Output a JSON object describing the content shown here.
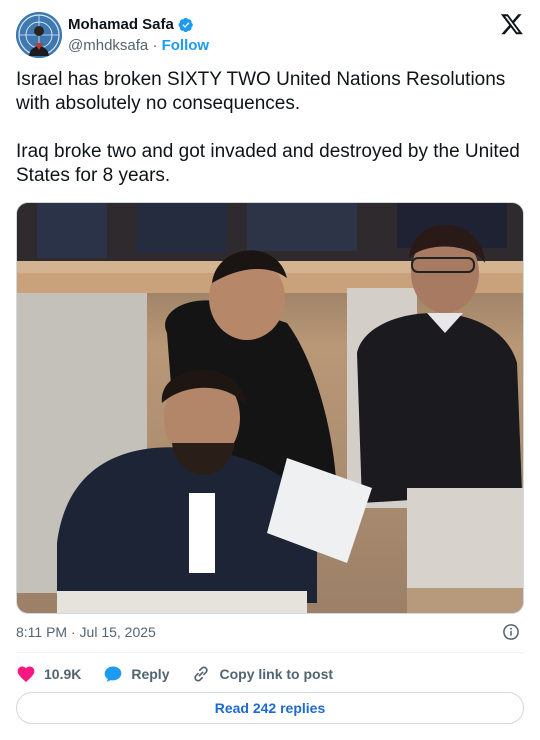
{
  "author": {
    "name": "Mohamad Safa",
    "handle": "@mhdksafa",
    "separator": "·",
    "follow_label": "Follow"
  },
  "post": {
    "text": "Israel has broken SIXTY TWO United Nations Resolutions with absolutely no consequences.\n\nIraq broke two and got invaded and destroyed by the United States for 8 years.",
    "timestamp": "8:11 PM · Jul 15, 2025"
  },
  "actions": {
    "likes": "10.9K",
    "reply_label": "Reply",
    "copy_label": "Copy link to post"
  },
  "read_replies_label": "Read 242 replies",
  "icons": [
    "verified-badge-icon",
    "x-logo-icon",
    "info-icon",
    "heart-icon",
    "reply-bubble-icon",
    "link-icon"
  ],
  "colors": {
    "accent": "#1d9bf0",
    "heart": "#f91880",
    "muted": "#536471",
    "text": "#0f1419"
  }
}
